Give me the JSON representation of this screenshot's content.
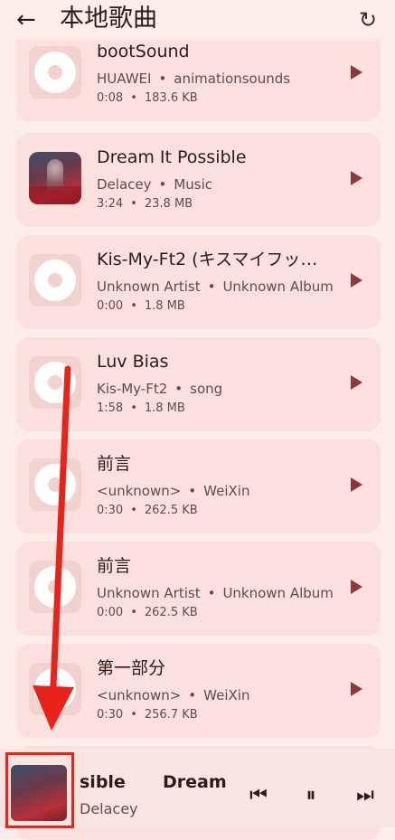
{
  "header": {
    "back_icon": "←",
    "title": "本地歌曲",
    "refresh_icon": "↻"
  },
  "songs": [
    {
      "title": "bootSound",
      "artist": "HUAWEI",
      "album": "animationsounds",
      "duration": "0:08",
      "size": "183.6 KB",
      "art": false
    },
    {
      "title": "Dream It Possible",
      "artist": "Delacey",
      "album": "Music",
      "duration": "3:24",
      "size": "23.8 MB",
      "art": true
    },
    {
      "title": "Kis-My-Ft2 (キスマイフッ…",
      "artist": "Unknown Artist",
      "album": "Unknown Album",
      "duration": "0:00",
      "size": "1.8 MB",
      "art": false
    },
    {
      "title": "Luv Bias",
      "artist": "Kis-My-Ft2",
      "album": "song",
      "duration": "1:58",
      "size": "1.8 MB",
      "art": false
    },
    {
      "title": "前言",
      "artist": "<unknown>",
      "album": "WeiXin",
      "duration": "0:30",
      "size": "262.5 KB",
      "art": false
    },
    {
      "title": "前言",
      "artist": "Unknown Artist",
      "album": "Unknown Album",
      "duration": "0:00",
      "size": "262.5 KB",
      "art": false
    },
    {
      "title": "第一部分",
      "artist": "<unknown>",
      "album": "WeiXin",
      "duration": "0:30",
      "size": "256.7 KB",
      "art": false
    }
  ],
  "separator": "•",
  "player": {
    "title_part1": "sible",
    "title_part2": "Dream",
    "artist": "Delacey",
    "prev_icon": "⏮",
    "pause_icon": "⏸",
    "next_icon": "⏭"
  }
}
